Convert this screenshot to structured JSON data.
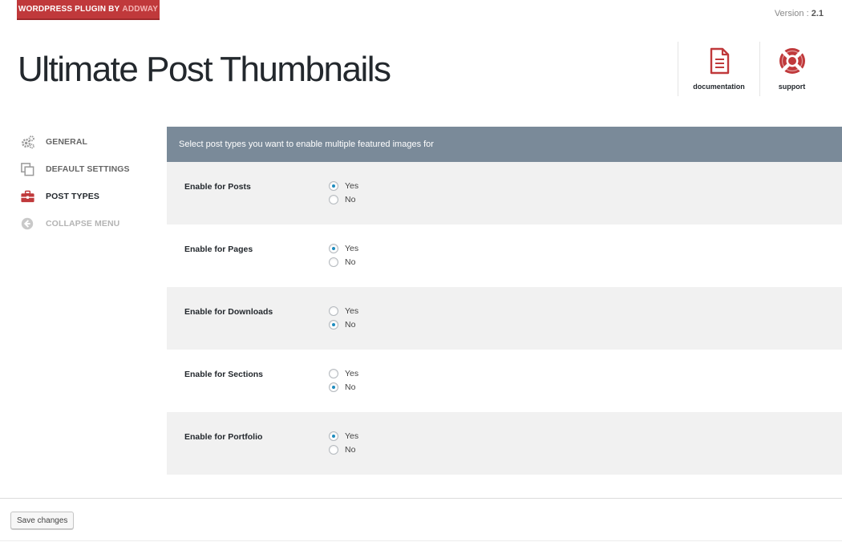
{
  "badge": {
    "prefix": "WORDPRESS PLUGIN BY",
    "brand": "ADDWAY"
  },
  "version": {
    "label": "Version :",
    "value": "2.1"
  },
  "title": "Ultimate Post Thumbnails",
  "help_links": [
    {
      "label": "documentation",
      "icon": "document-icon"
    },
    {
      "label": "support",
      "icon": "lifebuoy-icon"
    }
  ],
  "sidebar": {
    "items": [
      {
        "label": "GENERAL",
        "icon": "gears-icon",
        "state": "normal"
      },
      {
        "label": "DEFAULT SETTINGS",
        "icon": "copy-icon",
        "state": "normal"
      },
      {
        "label": "POST TYPES",
        "icon": "toolbox-icon",
        "state": "active"
      },
      {
        "label": "COLLAPSE MENU",
        "icon": "arrow-left-circle-icon",
        "state": "muted"
      }
    ]
  },
  "panel": {
    "header": "Select post types you want to enable multiple featured images for",
    "options": {
      "yes": "Yes",
      "no": "No"
    },
    "rows": [
      {
        "label": "Enable for Posts",
        "selected": "yes"
      },
      {
        "label": "Enable for Pages",
        "selected": "yes"
      },
      {
        "label": "Enable for Downloads",
        "selected": "no"
      },
      {
        "label": "Enable for Sections",
        "selected": "no"
      },
      {
        "label": "Enable for Portfolio",
        "selected": "yes"
      }
    ]
  },
  "footer": {
    "save_label": "Save changes"
  },
  "colors": {
    "brand_red": "#c0393b",
    "panel_header": "#7a8a99",
    "radio_checked": "#1e8cbe",
    "row_shade": "#f1f1f1"
  }
}
